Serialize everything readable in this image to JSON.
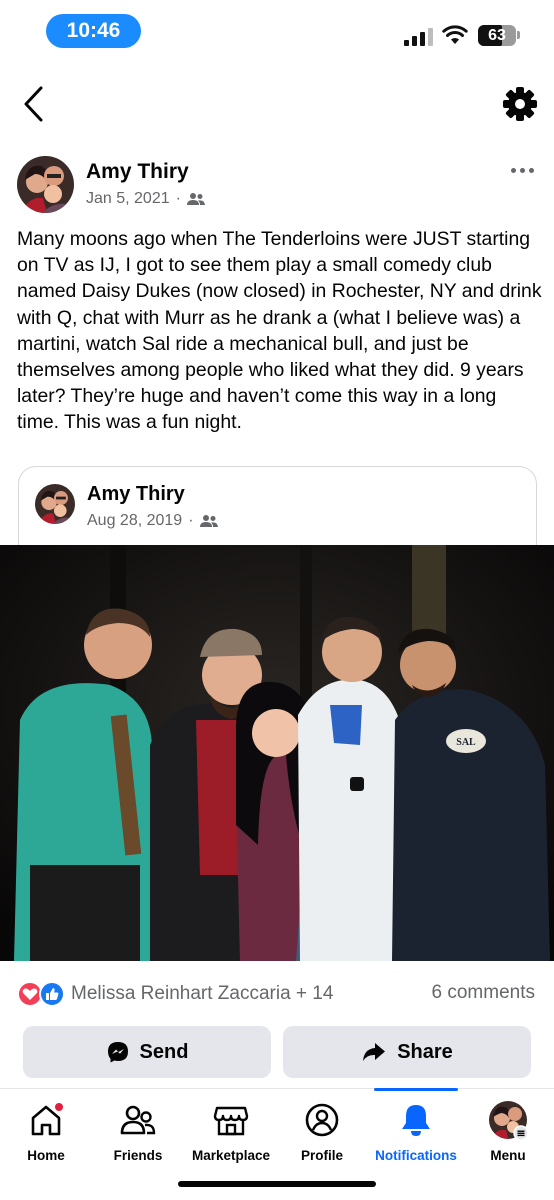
{
  "status_bar": {
    "time": "10:46",
    "battery": "63",
    "battery_level_percent": 63,
    "signal_icon": "cellular-signal-icon",
    "wifi_icon": "wifi-icon"
  },
  "header": {
    "back_icon": "chevron-left-icon",
    "settings_icon": "gear-icon"
  },
  "post": {
    "author": "Amy Thiry",
    "date": "Jan 5, 2021",
    "separator": "·",
    "audience_icon": "friends-audience-icon",
    "more_icon": "more-horizontal-icon",
    "text": "Many moons ago when The Tenderloins were JUST starting on TV as IJ, I got to see them play a small comedy club named Daisy Dukes (now closed) in Rochester, NY and drink with Q, chat with Murr as he drank a (what I believe was) a martini, watch Sal ride a mechanical bull, and just be themselves among people who liked what they did. 9 years later? They’re huge and haven’t come this way in a long time. This was a fun night."
  },
  "shared_post": {
    "author": "Amy Thiry",
    "date": "Aug 28, 2019",
    "separator": "·",
    "photo_shirt_text": "SAL"
  },
  "reactions": {
    "icons": [
      "love-reaction-icon",
      "like-reaction-icon"
    ],
    "summary": "Melissa Reinhart Zaccaria + 14",
    "comments": "6 comments"
  },
  "actions": {
    "send_label": "Send",
    "share_label": "Share"
  },
  "tabs": [
    {
      "label": "Home",
      "icon": "home-icon",
      "active": false,
      "badge": true
    },
    {
      "label": "Friends",
      "icon": "friends-icon",
      "active": false
    },
    {
      "label": "Marketplace",
      "icon": "marketplace-icon",
      "active": false
    },
    {
      "label": "Profile",
      "icon": "profile-icon",
      "active": false
    },
    {
      "label": "Notifications",
      "icon": "bell-icon",
      "active": true
    },
    {
      "label": "Menu",
      "icon": "menu-avatar-icon",
      "active": false
    }
  ],
  "colors": {
    "accent": "#0866ff",
    "time_pill": "#1a8cff",
    "secondary_text": "#65676b",
    "button_bg": "#e4e6eb",
    "love": "#f33e58",
    "like": "#1877f2"
  }
}
